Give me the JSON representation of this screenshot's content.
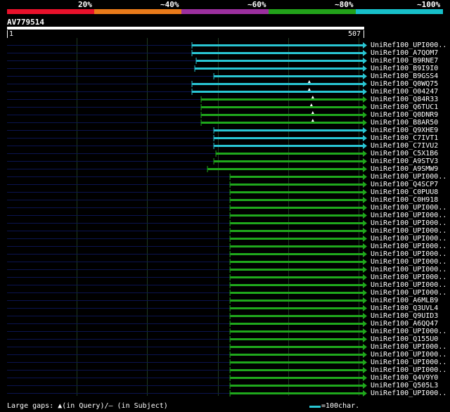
{
  "header": {
    "identity_scale": [
      {
        "label": "20%",
        "color": "#e8112b"
      },
      {
        "label": "~40%",
        "color": "#e87a1a"
      },
      {
        "label": "~60%",
        "color": "#9b2f9e"
      },
      {
        "label": "~80%",
        "color": "#22a11a"
      },
      {
        "label": "~100%",
        "color": "#17bfc9"
      }
    ]
  },
  "query": {
    "name": "AV779514",
    "start_label": "1",
    "end_label": "507",
    "length": 507
  },
  "colors": {
    "background": "#000000",
    "grid": "#1f3a22",
    "unaligned": "#0b1450",
    "cyan": "#29c6d4",
    "green": "#1fa81c",
    "gap_marker": "#ffffff"
  },
  "chart_data": {
    "type": "alignment-overview",
    "query_length": 507,
    "hits": [
      {
        "name": "UniRef100_UPI000..",
        "start": 264,
        "end": 507,
        "color": "cyan",
        "gap": null
      },
      {
        "name": "UniRef100_A7QOM7",
        "start": 264,
        "end": 507,
        "color": "cyan",
        "gap": null
      },
      {
        "name": "UniRef100_B9RNE7",
        "start": 270,
        "end": 507,
        "color": "cyan",
        "gap": null
      },
      {
        "name": "UniRef100_B9I9I0",
        "start": 268,
        "end": 507,
        "color": "cyan",
        "gap": null
      },
      {
        "name": "UniRef100_B9GSS4",
        "start": 295,
        "end": 507,
        "color": "cyan",
        "gap": null
      },
      {
        "name": "UniRef100_Q0WQ75",
        "start": 264,
        "end": 507,
        "color": "cyan",
        "gap": 430
      },
      {
        "name": "UniRef100_O04247",
        "start": 264,
        "end": 507,
        "color": "cyan",
        "gap": 430
      },
      {
        "name": "UniRef100_Q84R33",
        "start": 277,
        "end": 507,
        "color": "green",
        "gap": 435
      },
      {
        "name": "UniRef100_Q6TUC1",
        "start": 277,
        "end": 507,
        "color": "green",
        "gap": 433
      },
      {
        "name": "UniRef100_Q0DNR9",
        "start": 277,
        "end": 507,
        "color": "green",
        "gap": 435
      },
      {
        "name": "UniRef100_B8AR50",
        "start": 277,
        "end": 507,
        "color": "green",
        "gap": 435
      },
      {
        "name": "UniRef100_Q9XHE9",
        "start": 295,
        "end": 507,
        "color": "cyan",
        "gap": null
      },
      {
        "name": "UniRef100_C7IVT1",
        "start": 295,
        "end": 507,
        "color": "cyan",
        "gap": null
      },
      {
        "name": "UniRef100_C7IVU2",
        "start": 295,
        "end": 507,
        "color": "cyan",
        "gap": null
      },
      {
        "name": "UniRef100_C5X1B6",
        "start": 298,
        "end": 507,
        "color": "green",
        "gap": null
      },
      {
        "name": "UniRef100_A9STV3",
        "start": 295,
        "end": 507,
        "color": "green",
        "gap": null
      },
      {
        "name": "UniRef100_A9SMW9",
        "start": 286,
        "end": 507,
        "color": "green",
        "gap": null
      },
      {
        "name": "UniRef100_UPI000..",
        "start": 318,
        "end": 507,
        "color": "green",
        "gap": null
      },
      {
        "name": "UniRef100_Q4SCP7",
        "start": 318,
        "end": 507,
        "color": "green",
        "gap": null
      },
      {
        "name": "UniRef100_C0PUU8",
        "start": 318,
        "end": 507,
        "color": "green",
        "gap": null
      },
      {
        "name": "UniRef100_C0H918",
        "start": 318,
        "end": 507,
        "color": "green",
        "gap": null
      },
      {
        "name": "UniRef100_UPI000..",
        "start": 318,
        "end": 507,
        "color": "green",
        "gap": null
      },
      {
        "name": "UniRef100_UPI000..",
        "start": 318,
        "end": 507,
        "color": "green",
        "gap": null
      },
      {
        "name": "UniRef100_UPI000..",
        "start": 318,
        "end": 507,
        "color": "green",
        "gap": null
      },
      {
        "name": "UniRef100_UPI000..",
        "start": 318,
        "end": 507,
        "color": "green",
        "gap": null
      },
      {
        "name": "UniRef100_UPI000..",
        "start": 318,
        "end": 507,
        "color": "green",
        "gap": null
      },
      {
        "name": "UniRef100_UPI000..",
        "start": 318,
        "end": 507,
        "color": "green",
        "gap": null
      },
      {
        "name": "UniRef100_UPI000..",
        "start": 318,
        "end": 507,
        "color": "green",
        "gap": null
      },
      {
        "name": "UniRef100_UPI000..",
        "start": 318,
        "end": 507,
        "color": "green",
        "gap": null
      },
      {
        "name": "UniRef100_UPI000..",
        "start": 318,
        "end": 507,
        "color": "green",
        "gap": null
      },
      {
        "name": "UniRef100_UPI000..",
        "start": 318,
        "end": 507,
        "color": "green",
        "gap": null
      },
      {
        "name": "UniRef100_UPI000..",
        "start": 318,
        "end": 507,
        "color": "green",
        "gap": null
      },
      {
        "name": "UniRef100_UPI000..",
        "start": 318,
        "end": 507,
        "color": "green",
        "gap": null
      },
      {
        "name": "UniRef100_A6MLB9",
        "start": 318,
        "end": 507,
        "color": "green",
        "gap": null
      },
      {
        "name": "UniRef100_Q3UVL4",
        "start": 318,
        "end": 507,
        "color": "green",
        "gap": null
      },
      {
        "name": "UniRef100_Q9UID3",
        "start": 318,
        "end": 507,
        "color": "green",
        "gap": null
      },
      {
        "name": "UniRef100_A6QQ47",
        "start": 318,
        "end": 507,
        "color": "green",
        "gap": null
      },
      {
        "name": "UniRef100_UPI000..",
        "start": 318,
        "end": 507,
        "color": "green",
        "gap": null
      },
      {
        "name": "UniRef100_Q155U0",
        "start": 318,
        "end": 507,
        "color": "green",
        "gap": null
      },
      {
        "name": "UniRef100_UPI000..",
        "start": 318,
        "end": 507,
        "color": "green",
        "gap": null
      },
      {
        "name": "UniRef100_UPI000..",
        "start": 318,
        "end": 507,
        "color": "green",
        "gap": null
      },
      {
        "name": "UniRef100_UPI000..",
        "start": 318,
        "end": 507,
        "color": "green",
        "gap": null
      },
      {
        "name": "UniRef100_UPI000..",
        "start": 318,
        "end": 507,
        "color": "green",
        "gap": null
      },
      {
        "name": "UniRef100_Q4V9Y0",
        "start": 318,
        "end": 507,
        "color": "green",
        "gap": null
      },
      {
        "name": "UniRef100_Q505L3",
        "start": 318,
        "end": 507,
        "color": "green",
        "gap": null
      },
      {
        "name": "UniRef100_UPI000..",
        "start": 318,
        "end": 507,
        "color": "green",
        "gap": null
      }
    ]
  },
  "footer": {
    "gaps_text": "Large gaps: ▲(in Query)/– (in Subject)",
    "scale_text": "=100char."
  }
}
